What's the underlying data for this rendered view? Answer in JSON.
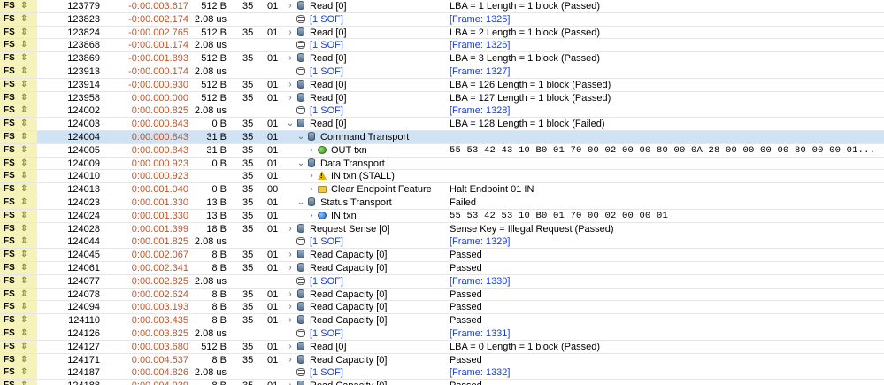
{
  "rows": [
    {
      "speed": "FS",
      "seq": "123779",
      "time": "-0:00.003.617",
      "len": "512 B",
      "addr": "35",
      "ep": "01",
      "level": 0,
      "arrow": "right",
      "icon": "disk-icon",
      "record": "Read [0]",
      "summary": "LBA = 1 Length = 1 block (Passed)",
      "sumtype": "text"
    },
    {
      "speed": "FS",
      "seq": "123823",
      "time": "-0:00.002.174",
      "len": "2.08 us",
      "addr": "",
      "ep": "",
      "level": 0,
      "arrow": "",
      "icon": "sof-icon",
      "record": "[1 SOF]",
      "summary": "[Frame: 1325]",
      "sumtype": "link"
    },
    {
      "speed": "FS",
      "seq": "123824",
      "time": "-0:00.002.765",
      "len": "512 B",
      "addr": "35",
      "ep": "01",
      "level": 0,
      "arrow": "right",
      "icon": "disk-icon",
      "record": "Read [0]",
      "summary": "LBA = 2 Length = 1 block (Passed)",
      "sumtype": "text"
    },
    {
      "speed": "FS",
      "seq": "123868",
      "time": "-0:00.001.174",
      "len": "2.08 us",
      "addr": "",
      "ep": "",
      "level": 0,
      "arrow": "",
      "icon": "sof-icon",
      "record": "[1 SOF]",
      "summary": "[Frame: 1326]",
      "sumtype": "link"
    },
    {
      "speed": "FS",
      "seq": "123869",
      "time": "-0:00.001.893",
      "len": "512 B",
      "addr": "35",
      "ep": "01",
      "level": 0,
      "arrow": "right",
      "icon": "disk-icon",
      "record": "Read [0]",
      "summary": "LBA = 3 Length = 1 block (Passed)",
      "sumtype": "text"
    },
    {
      "speed": "FS",
      "seq": "123913",
      "time": "-0:00.000.174",
      "len": "2.08 us",
      "addr": "",
      "ep": "",
      "level": 0,
      "arrow": "",
      "icon": "sof-icon",
      "record": "[1 SOF]",
      "summary": "[Frame: 1327]",
      "sumtype": "link"
    },
    {
      "speed": "FS",
      "seq": "123914",
      "time": "-0:00.000.930",
      "len": "512 B",
      "addr": "35",
      "ep": "01",
      "level": 0,
      "arrow": "right",
      "icon": "disk-icon",
      "record": "Read [0]",
      "summary": "LBA = 126 Length = 1 block (Passed)",
      "sumtype": "text"
    },
    {
      "speed": "FS",
      "seq": "123958",
      "time": "0:00.000.000",
      "len": "512 B",
      "addr": "35",
      "ep": "01",
      "level": 0,
      "arrow": "right",
      "icon": "disk-icon",
      "record": "Read [0]",
      "summary": "LBA = 127 Length = 1 block (Passed)",
      "sumtype": "text"
    },
    {
      "speed": "FS",
      "seq": "124002",
      "time": "0:00.000.825",
      "len": "2.08 us",
      "addr": "",
      "ep": "",
      "level": 0,
      "arrow": "",
      "icon": "sof-icon",
      "record": "[1 SOF]",
      "summary": "[Frame: 1328]",
      "sumtype": "link"
    },
    {
      "speed": "FS",
      "seq": "124003",
      "time": "0:00.000.843",
      "len": "0 B",
      "addr": "35",
      "ep": "01",
      "level": 0,
      "arrow": "down",
      "icon": "disk-icon",
      "record": "Read [0]",
      "summary": "LBA = 128 Length = 1 block (Failed)",
      "sumtype": "text"
    },
    {
      "speed": "FS",
      "seq": "124004",
      "time": "0:00.000.843",
      "len": "31 B",
      "addr": "35",
      "ep": "01",
      "level": 1,
      "arrow": "down",
      "icon": "disk-icon",
      "record": "Command Transport",
      "summary": "",
      "sumtype": "text",
      "selected": true
    },
    {
      "speed": "FS",
      "seq": "124005",
      "time": "0:00.000.843",
      "len": "31 B",
      "addr": "35",
      "ep": "01",
      "level": 2,
      "arrow": "right",
      "icon": "out-txn-icon",
      "record": "OUT txn",
      "summary": "55 53 42 43 10 B0 01 70 00 02 00 00 80 00 0A 28 00 00 00 00 80 00 00 01...",
      "sumtype": "hex"
    },
    {
      "speed": "FS",
      "seq": "124009",
      "time": "0:00.000.923",
      "len": "0 B",
      "addr": "35",
      "ep": "01",
      "level": 1,
      "arrow": "down",
      "icon": "disk-icon",
      "record": "Data Transport",
      "summary": "",
      "sumtype": "text"
    },
    {
      "speed": "FS",
      "seq": "124010",
      "time": "0:00.000.923",
      "len": "",
      "addr": "35",
      "ep": "01",
      "level": 2,
      "arrow": "right",
      "icon": "warning-icon",
      "record": "IN txn (STALL)",
      "summary": "",
      "sumtype": "text"
    },
    {
      "speed": "FS",
      "seq": "124013",
      "time": "0:00.001.040",
      "len": "0 B",
      "addr": "35",
      "ep": "00",
      "level": 2,
      "arrow": "right",
      "icon": "folder-icon",
      "record": "Clear Endpoint Feature",
      "summary": "Halt Endpoint 01 IN",
      "sumtype": "text"
    },
    {
      "speed": "FS",
      "seq": "124023",
      "time": "0:00.001.330",
      "len": "13 B",
      "addr": "35",
      "ep": "01",
      "level": 1,
      "arrow": "down",
      "icon": "disk-icon",
      "record": "Status Transport",
      "summary": "Failed",
      "sumtype": "text"
    },
    {
      "speed": "FS",
      "seq": "124024",
      "time": "0:00.001.330",
      "len": "13 B",
      "addr": "35",
      "ep": "01",
      "level": 2,
      "arrow": "right",
      "icon": "in-txn-icon",
      "record": "IN txn",
      "summary": "55 53 42 53 10 B0 01 70 00 02 00 00 01",
      "sumtype": "hex"
    },
    {
      "speed": "FS",
      "seq": "124028",
      "time": "0:00.001.399",
      "len": "18 B",
      "addr": "35",
      "ep": "01",
      "level": 0,
      "arrow": "right",
      "icon": "disk-icon",
      "record": "Request Sense [0]",
      "summary": "Sense Key = Illegal Request (Passed)",
      "sumtype": "text"
    },
    {
      "speed": "FS",
      "seq": "124044",
      "time": "0:00.001.825",
      "len": "2.08 us",
      "addr": "",
      "ep": "",
      "level": 0,
      "arrow": "",
      "icon": "sof-icon",
      "record": "[1 SOF]",
      "summary": "[Frame: 1329]",
      "sumtype": "link"
    },
    {
      "speed": "FS",
      "seq": "124045",
      "time": "0:00.002.067",
      "len": "8 B",
      "addr": "35",
      "ep": "01",
      "level": 0,
      "arrow": "right",
      "icon": "disk-icon",
      "record": "Read Capacity [0]",
      "summary": "Passed",
      "sumtype": "text"
    },
    {
      "speed": "FS",
      "seq": "124061",
      "time": "0:00.002.341",
      "len": "8 B",
      "addr": "35",
      "ep": "01",
      "level": 0,
      "arrow": "right",
      "icon": "disk-icon",
      "record": "Read Capacity [0]",
      "summary": "Passed",
      "sumtype": "text"
    },
    {
      "speed": "FS",
      "seq": "124077",
      "time": "0:00.002.825",
      "len": "2.08 us",
      "addr": "",
      "ep": "",
      "level": 0,
      "arrow": "",
      "icon": "sof-icon",
      "record": "[1 SOF]",
      "summary": "[Frame: 1330]",
      "sumtype": "link"
    },
    {
      "speed": "FS",
      "seq": "124078",
      "time": "0:00.002.624",
      "len": "8 B",
      "addr": "35",
      "ep": "01",
      "level": 0,
      "arrow": "right",
      "icon": "disk-icon",
      "record": "Read Capacity [0]",
      "summary": "Passed",
      "sumtype": "text"
    },
    {
      "speed": "FS",
      "seq": "124094",
      "time": "0:00.003.193",
      "len": "8 B",
      "addr": "35",
      "ep": "01",
      "level": 0,
      "arrow": "right",
      "icon": "disk-icon",
      "record": "Read Capacity [0]",
      "summary": "Passed",
      "sumtype": "text"
    },
    {
      "speed": "FS",
      "seq": "124110",
      "time": "0:00.003.435",
      "len": "8 B",
      "addr": "35",
      "ep": "01",
      "level": 0,
      "arrow": "right",
      "icon": "disk-icon",
      "record": "Read Capacity [0]",
      "summary": "Passed",
      "sumtype": "text"
    },
    {
      "speed": "FS",
      "seq": "124126",
      "time": "0:00.003.825",
      "len": "2.08 us",
      "addr": "",
      "ep": "",
      "level": 0,
      "arrow": "",
      "icon": "sof-icon",
      "record": "[1 SOF]",
      "summary": "[Frame: 1331]",
      "sumtype": "link"
    },
    {
      "speed": "FS",
      "seq": "124127",
      "time": "0:00.003.680",
      "len": "512 B",
      "addr": "35",
      "ep": "01",
      "level": 0,
      "arrow": "right",
      "icon": "disk-icon",
      "record": "Read [0]",
      "summary": "LBA = 0 Length = 1 block (Passed)",
      "sumtype": "text"
    },
    {
      "speed": "FS",
      "seq": "124171",
      "time": "0:00.004.537",
      "len": "8 B",
      "addr": "35",
      "ep": "01",
      "level": 0,
      "arrow": "right",
      "icon": "disk-icon",
      "record": "Read Capacity [0]",
      "summary": "Passed",
      "sumtype": "text"
    },
    {
      "speed": "FS",
      "seq": "124187",
      "time": "0:00.004.826",
      "len": "2.08 us",
      "addr": "",
      "ep": "",
      "level": 0,
      "arrow": "",
      "icon": "sof-icon",
      "record": "[1 SOF]",
      "summary": "[Frame: 1332]",
      "sumtype": "link"
    },
    {
      "speed": "FS",
      "seq": "124188",
      "time": "0:00.004.939",
      "len": "8 B",
      "addr": "35",
      "ep": "01",
      "level": 0,
      "arrow": "right",
      "icon": "disk-icon",
      "record": "Read Capacity [0]",
      "summary": "Passed",
      "sumtype": "text"
    }
  ],
  "colors": {
    "speed_bg": "#f6f3ba",
    "time_text": "#c0562c",
    "link_text": "#1a3fd6",
    "selected_bg": "#cfe3f4"
  }
}
